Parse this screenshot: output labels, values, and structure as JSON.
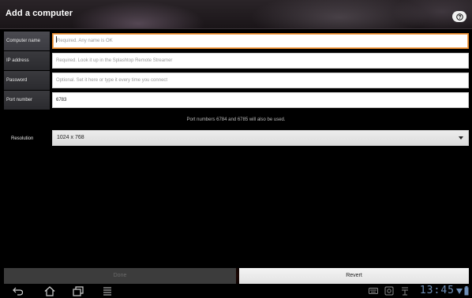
{
  "header": {
    "title": "Add a computer",
    "help_icon": "help-icon"
  },
  "form": {
    "fields": [
      {
        "label": "Computer name",
        "placeholder": "Required. Any name is OK",
        "value": ""
      },
      {
        "label": "IP address",
        "placeholder": "Required. Look it up in the Splashtop Remote Streamer",
        "value": ""
      },
      {
        "label": "Password",
        "placeholder": "Optional. Set it here or type it every time you connect",
        "value": ""
      },
      {
        "label": "Port number",
        "placeholder": "",
        "value": "6783"
      }
    ],
    "port_hint": "Port numbers 6784 and 6785 will also be used.",
    "resolution": {
      "label": "Resolution",
      "selected": "1024 x 768"
    }
  },
  "buttons": {
    "done": "Done",
    "revert": "Revert"
  },
  "system_bar": {
    "clock": "13:45",
    "icons": [
      "back-icon",
      "home-icon",
      "recent-apps-icon",
      "menu-icon",
      "keyboard-icon",
      "screenshot-icon",
      "usb-icon",
      "wifi-icon",
      "battery-icon"
    ]
  },
  "colors": {
    "focus_border": "#e3872a",
    "clock": "#6f8fb8"
  }
}
